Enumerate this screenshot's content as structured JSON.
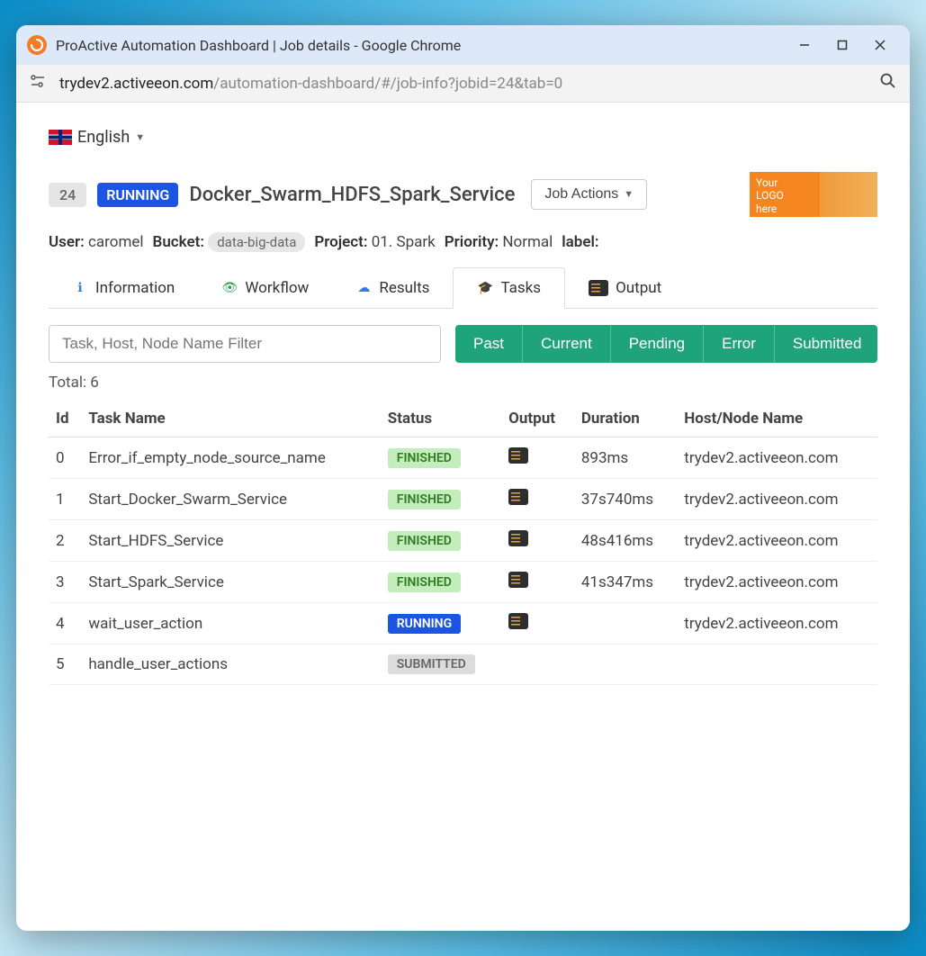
{
  "window": {
    "title": "ProActive Automation Dashboard | Job details - Google Chrome",
    "url_host": "trydev2.activeeon.com",
    "url_path": "/automation-dashboard/#/job-info?jobid=24&tab=0"
  },
  "lang": {
    "label": "English"
  },
  "job": {
    "id": "24",
    "status": "RUNNING",
    "name": "Docker_Swarm_HDFS_Spark_Service",
    "actions_label": "Job Actions"
  },
  "logo": {
    "line1": "Your",
    "line2": "LOGO",
    "line3": "here"
  },
  "meta": {
    "user_label": "User:",
    "user": "caromel",
    "bucket_label": "Bucket:",
    "bucket": "data-big-data",
    "project_label": "Project:",
    "project": "01. Spark",
    "priority_label": "Priority:",
    "priority": "Normal",
    "label_label": "label:"
  },
  "tabs": [
    {
      "label": "Information",
      "icon": "ℹ",
      "color": "c-blue"
    },
    {
      "label": "Workflow",
      "icon": "👁",
      "color": "c-green"
    },
    {
      "label": "Results",
      "icon": "☁",
      "color": "c-blue"
    },
    {
      "label": "Tasks",
      "icon": "🎓",
      "color": "c-blue",
      "active": true
    },
    {
      "label": "Output",
      "icon": "out",
      "color": ""
    }
  ],
  "filter": {
    "placeholder": "Task, Host, Node Name Filter"
  },
  "filter_buttons": [
    "Past",
    "Current",
    "Pending",
    "Error",
    "Submitted"
  ],
  "total": {
    "label": "Total: ",
    "count": "6"
  },
  "columns": [
    "Id",
    "Task Name",
    "Status",
    "Output",
    "Duration",
    "Host/Node Name"
  ],
  "rows": [
    {
      "id": "0",
      "name": "Error_if_empty_node_source_name",
      "status": "FINISHED",
      "status_class": "b-finished",
      "has_output": true,
      "duration": "893ms",
      "host": "trydev2.activeeon.com"
    },
    {
      "id": "1",
      "name": "Start_Docker_Swarm_Service",
      "status": "FINISHED",
      "status_class": "b-finished",
      "has_output": true,
      "duration": "37s740ms",
      "host": "trydev2.activeeon.com"
    },
    {
      "id": "2",
      "name": "Start_HDFS_Service",
      "status": "FINISHED",
      "status_class": "b-finished",
      "has_output": true,
      "duration": "48s416ms",
      "host": "trydev2.activeeon.com"
    },
    {
      "id": "3",
      "name": "Start_Spark_Service",
      "status": "FINISHED",
      "status_class": "b-finished",
      "has_output": true,
      "duration": "41s347ms",
      "host": "trydev2.activeeon.com"
    },
    {
      "id": "4",
      "name": "wait_user_action",
      "status": "RUNNING",
      "status_class": "b-running",
      "has_output": true,
      "duration": "",
      "host": "trydev2.activeeon.com"
    },
    {
      "id": "5",
      "name": "handle_user_actions",
      "status": "SUBMITTED",
      "status_class": "b-submitted",
      "has_output": false,
      "duration": "",
      "host": ""
    }
  ]
}
